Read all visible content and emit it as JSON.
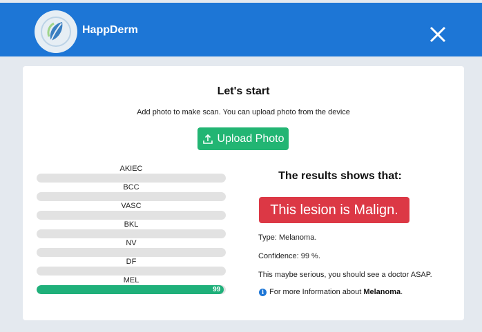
{
  "app": {
    "name": "HappDerm"
  },
  "header": {
    "close_icon": "close-icon",
    "logo_icon": "leaf-logo-icon"
  },
  "intro": {
    "title": "Let's start",
    "subtitle": "Add photo to make scan. You can upload photo from the device",
    "upload_label": "Upload Photo",
    "upload_icon": "upload-icon"
  },
  "classes": [
    {
      "label": "AKIEC",
      "value": null
    },
    {
      "label": "BCC",
      "value": null
    },
    {
      "label": "VASC",
      "value": null
    },
    {
      "label": "BKL",
      "value": null
    },
    {
      "label": "NV",
      "value": null
    },
    {
      "label": "DF",
      "value": null
    },
    {
      "label": "MEL",
      "value": 99,
      "value_text": "99"
    }
  ],
  "results": {
    "title": "The results shows that:",
    "verdict": "This lesion is Malign.",
    "type_line": "Type: Melanoma.",
    "confidence_line": "Confidence: 99 %.",
    "advice_line": "This maybe serious, you should see a doctor ASAP.",
    "more_prefix": "For more Information about ",
    "more_link": "Melanoma",
    "more_suffix": "."
  },
  "colors": {
    "header": "#1d76d6",
    "primary_green": "#22b573",
    "danger": "#dc3845"
  }
}
